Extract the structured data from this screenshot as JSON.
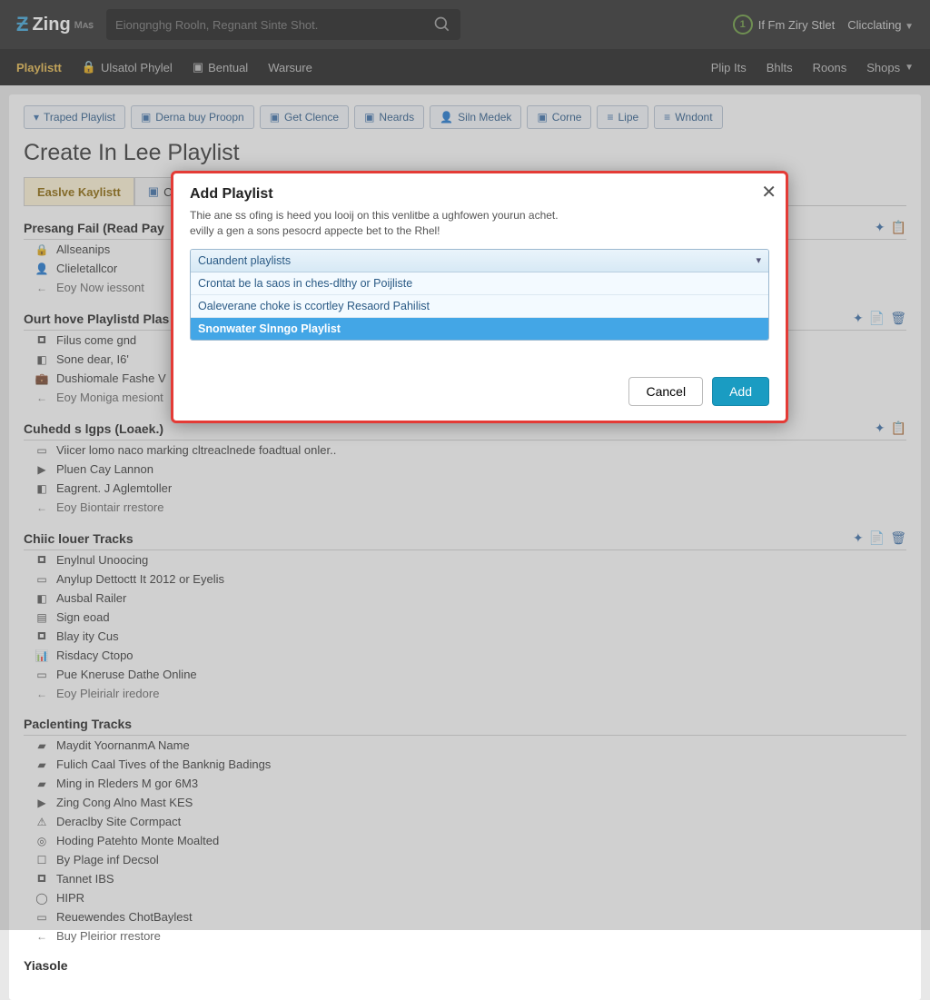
{
  "header": {
    "brand": "Zing",
    "brand_sub": "Mᴀꜱ",
    "search_placeholder": "Eiongnghg Rooln, Regnant Sinte Shot.",
    "user_badge_num": "1",
    "user_text": "If Fm Ziry Stlet",
    "account_label": "Clicclating"
  },
  "nav": {
    "items": [
      "Playlistt",
      "Ulsatol Phylel",
      "Bentual",
      "Warsure"
    ],
    "right": [
      "Plip Its",
      "Bhlts",
      "Roons",
      "Shops"
    ]
  },
  "toolbar": [
    {
      "icon": "▾",
      "label": "Traped Playlist"
    },
    {
      "icon": "▣",
      "label": "Derna buy Proopn"
    },
    {
      "icon": "▣",
      "label": "Get Clence"
    },
    {
      "icon": "▣",
      "label": "Neards"
    },
    {
      "icon": "👤",
      "label": "Siln Medek"
    },
    {
      "icon": "▣",
      "label": "Corne"
    },
    {
      "icon": "≡",
      "label": "Lipe"
    },
    {
      "icon": "≡",
      "label": "Wndont"
    }
  ],
  "page_title": "Create In Lee Playlist",
  "tabs": {
    "active": "Easlve Kaylistt",
    "second_icon": "▣",
    "second": "C"
  },
  "sections": [
    {
      "title": "Presang Fail (Read Pay",
      "rows": [
        {
          "icon": "🔒",
          "text": "Allseanips"
        },
        {
          "icon": "👤",
          "text": "Clieletallcor"
        },
        {
          "icon": "←",
          "text": "Eoy Now iessont",
          "back": true
        }
      ],
      "actions": [
        "✦",
        "📋"
      ]
    },
    {
      "title": "Ourt hove Playlistd Plas",
      "rows": [
        {
          "icon": "🞓",
          "text": "Filus come gnd"
        },
        {
          "icon": "◧",
          "text": "Sone dear, I6'"
        },
        {
          "icon": "💼",
          "text": "Dushiomale Fashe V"
        },
        {
          "icon": "←",
          "text": "Eoy Moniga mesiont",
          "back": true
        }
      ],
      "actions": [
        "✦",
        "📄",
        "🗑"
      ]
    },
    {
      "title": "Cuhedd s lgps (Loaek.)",
      "rows": [
        {
          "icon": "▭",
          "text": "Viicer lomo naco marking cltreaclnede foadtual onler.."
        },
        {
          "icon": "▶",
          "text": "Pluen Cay Lannon"
        },
        {
          "icon": "◧",
          "text": "Eagrent. J Aglemtoller"
        },
        {
          "icon": "←",
          "text": "Eoy Biontair rrestore",
          "back": true
        }
      ],
      "actions": [
        "✦",
        "📋"
      ]
    },
    {
      "title": "Chiic louer Tracks",
      "rows": [
        {
          "icon": "🞓",
          "text": "Enylnul Unoocing"
        },
        {
          "icon": "▭",
          "text": "Anylup Dettoctt It 2012 or Eyelis"
        },
        {
          "icon": "◧",
          "text": "Ausbal Railer"
        },
        {
          "icon": "▤",
          "text": "Sign eoad"
        },
        {
          "icon": "🞓",
          "text": "Blay ity Cus"
        },
        {
          "icon": "📊",
          "text": "Risdacy Ctopo"
        },
        {
          "icon": "▭",
          "text": "Pue Kneruse Dathe Online"
        },
        {
          "icon": "←",
          "text": "Eoy Pleirialr iredore",
          "back": true
        }
      ],
      "actions": [
        "✦",
        "📄",
        "🗑"
      ]
    },
    {
      "title": "Paclenting Tracks",
      "rows": [
        {
          "icon": "▰",
          "text": "Maydit YoornanmA Name"
        },
        {
          "icon": "▰",
          "text": "Fulich Caal Tives of the Banknig Badings"
        },
        {
          "icon": "▰",
          "text": "Ming in Rleders M gor 6M3"
        },
        {
          "icon": "▶",
          "text": "Zing Cong Alno Mast KES"
        },
        {
          "icon": "⚠",
          "text": "Deraclby Site Cormpact"
        },
        {
          "icon": "◎",
          "text": "Hoding Patehto Monte Moalted"
        },
        {
          "icon": "☐",
          "text": "By Plage inf Decsol"
        },
        {
          "icon": "🞓",
          "text": "Tannet IBS"
        },
        {
          "icon": "◯",
          "text": "HIPR"
        },
        {
          "icon": "▭",
          "text": "Reuewendes ChotBaylest"
        },
        {
          "icon": "←",
          "text": "Buy Pleirior rrestore",
          "back": true
        }
      ],
      "actions": []
    }
  ],
  "footer_word": "Yiasole",
  "modal": {
    "title": "Add Playlist",
    "desc1": "Thie ane ss ofing is heed you looij on this venlitbe a ughfowen yourun achet.",
    "desc2": "evilly a gen a sons pesocrd appecte bet to the Rhel!",
    "select_label": "Cuandent playlists",
    "options": [
      "Crontat be la saos in ches-dlthy or Poijliste",
      "Oaleverane choke is ccortley Resaord Pahilist",
      "Snonwater Slnngo Playlist"
    ],
    "cancel": "Cancel",
    "add": "Add"
  }
}
